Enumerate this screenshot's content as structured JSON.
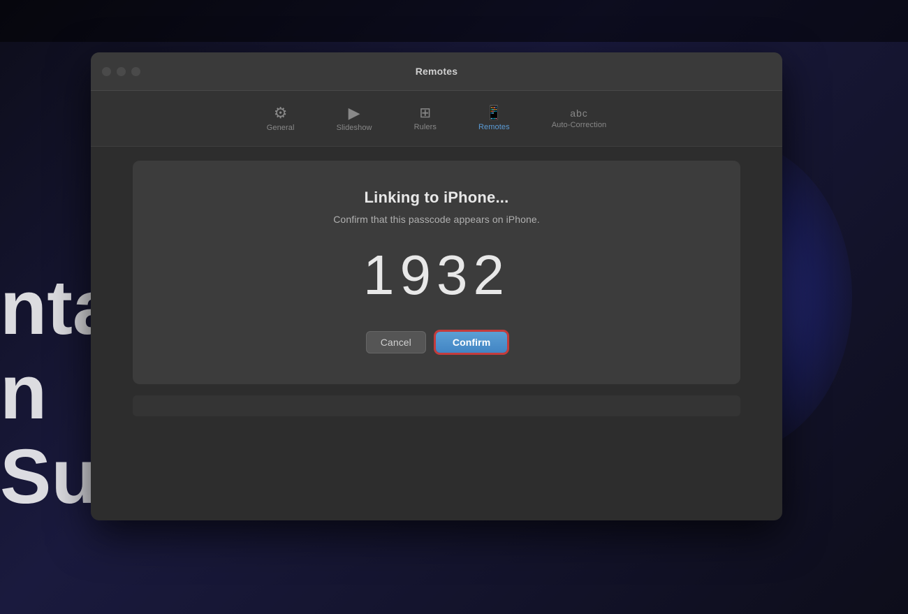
{
  "background": {
    "text_line1": "nta",
    "text_line2": "n Sub"
  },
  "window": {
    "title": "Remotes",
    "controls": {
      "close_label": "",
      "minimize_label": "",
      "maximize_label": ""
    }
  },
  "toolbar": {
    "tabs": [
      {
        "id": "general",
        "label": "General",
        "icon": "⚙"
      },
      {
        "id": "slideshow",
        "label": "Slideshow",
        "icon": "▶"
      },
      {
        "id": "rulers",
        "label": "Rulers",
        "icon": "⊞"
      },
      {
        "id": "remotes",
        "label": "Remotes",
        "icon": "📱",
        "active": true
      },
      {
        "id": "auto-correction",
        "label": "Auto-Correction",
        "icon": "abc"
      }
    ]
  },
  "dialog": {
    "title": "Linking to iPhone...",
    "subtitle": "Confirm that this passcode appears on iPhone.",
    "passcode": "1932",
    "cancel_label": "Cancel",
    "confirm_label": "Confirm"
  }
}
